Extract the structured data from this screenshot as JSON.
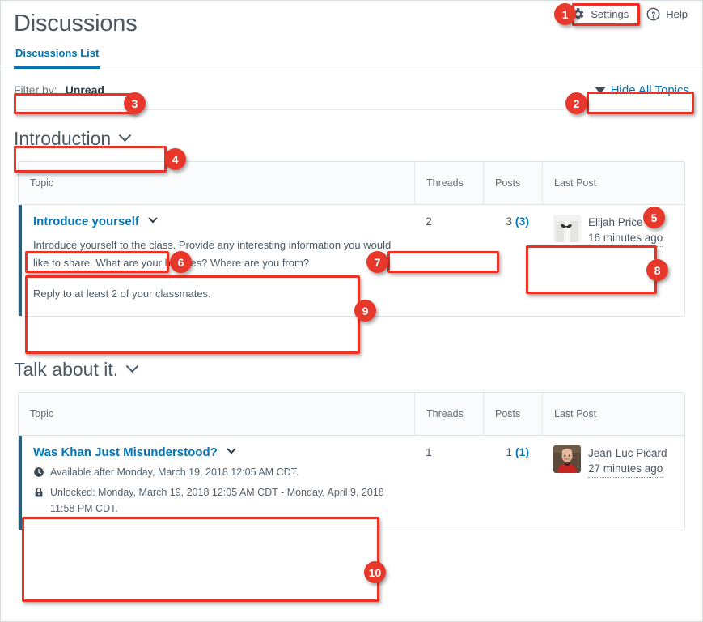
{
  "header": {
    "title": "Discussions",
    "settings_label": "Settings",
    "help_label": "Help",
    "gear_icon": "gear-icon",
    "help_icon": "question-circle-icon"
  },
  "tabs": [
    {
      "label": "Discussions List",
      "active": true
    }
  ],
  "filter": {
    "label": "Filter by:",
    "value": "Unread",
    "hide_all_topics_label": "Hide All Topics",
    "caret_icon": "triangle-down-icon"
  },
  "columns": {
    "topic": "Topic",
    "threads": "Threads",
    "posts": "Posts",
    "last_post": "Last Post"
  },
  "groups": [
    {
      "title": "Introduction",
      "chevron_icon": "chevron-down-icon",
      "rows": [
        {
          "title": "Introduce yourself",
          "chevron_icon": "chevron-down-icon",
          "description_paragraphs": [
            "Introduce yourself to the class. Provide any interesting information you would like to share. What are your hobbies? Where are you from?",
            "Reply to at least 2 of your classmates."
          ],
          "threads": "2",
          "posts_total": "3",
          "posts_unread": "(3)",
          "last_post_author": "Elijah Price",
          "last_post_time": "16 minutes ago",
          "avatar_kind": "mustache-placeholder-avatar",
          "unread": true
        }
      ]
    },
    {
      "title": "Talk about it.",
      "chevron_icon": "chevron-down-icon",
      "rows": [
        {
          "title": "Was Khan Just Misunderstood?",
          "chevron_icon": "chevron-down-icon",
          "availability_icon": "clock-icon",
          "availability_text": "Available after Monday, March 19, 2018 12:05 AM CDT.",
          "lock_icon": "lock-icon",
          "lock_text": "Unlocked: Monday, March 19, 2018 12:05 AM CDT - Monday, April 9, 2018 11:58 PM CDT.",
          "threads": "1",
          "posts_total": "1",
          "posts_unread": "(1)",
          "last_post_author": "Jean-Luc Picard",
          "last_post_time": "27 minutes ago",
          "avatar_kind": "photo-avatar",
          "unread": true
        }
      ]
    }
  ],
  "callouts": [
    {
      "n": "1"
    },
    {
      "n": "2"
    },
    {
      "n": "3"
    },
    {
      "n": "4"
    },
    {
      "n": "5"
    },
    {
      "n": "6"
    },
    {
      "n": "7"
    },
    {
      "n": "8"
    },
    {
      "n": "9"
    },
    {
      "n": "10"
    }
  ],
  "colors": {
    "link_blue": "#0374b5",
    "heading_gray": "#4a5763",
    "unread_bar": "#2b5f79",
    "callout_red": "#ee3124"
  }
}
